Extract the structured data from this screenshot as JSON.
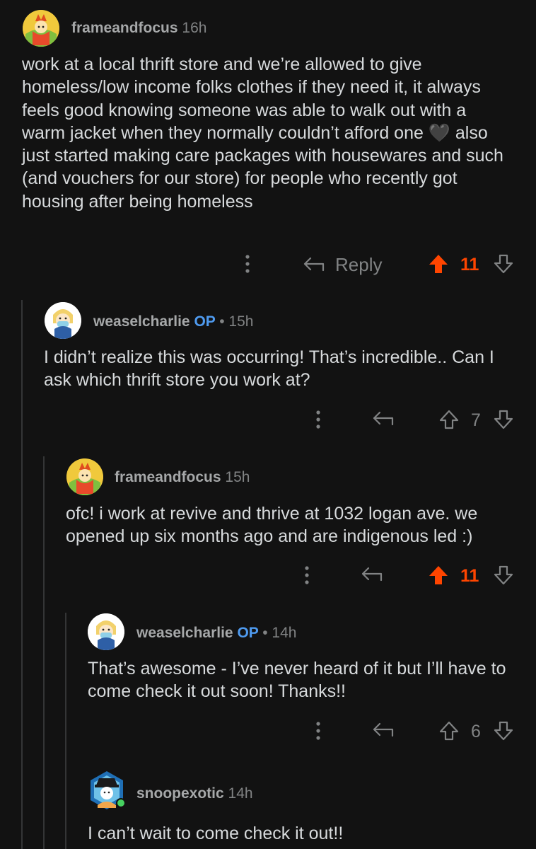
{
  "colors": {
    "background": "#121212",
    "text": "#d7dadc",
    "meta": "#818384",
    "op": "#4f9bf0",
    "upvoted": "#ff4500",
    "thread_line": "#343536"
  },
  "comments": [
    {
      "author": "frameandfocus",
      "time": "16h",
      "body": "work at a local thrift store and we’re allowed to give homeless/low income folks clothes if they need it, it always feels good knowing someone was able to walk out with a warm jacket when they normally couldn’t afford one 🖤 also just started making care packages with housewares and such (and vouchers for our store) for people who recently got housing after being homeless",
      "reply_label": "Reply",
      "votes": "11",
      "upvoted": true
    },
    {
      "author": "weaselcharlie",
      "op_badge": "OP",
      "time": "• 15h",
      "body": "I didn’t realize this was occurring! That’s incredible.. Can I ask which thrift store you work at?",
      "votes": "7",
      "upvoted": false
    },
    {
      "author": "frameandfocus",
      "time": "15h",
      "body": "ofc! i work at revive and thrive at 1032 logan ave. we opened up six months ago and are indigenous led :)",
      "votes": "11",
      "upvoted": true
    },
    {
      "author": "weaselcharlie",
      "op_badge": "OP",
      "time": "• 14h",
      "body": "That’s awesome - I’ve never heard of it but I’ll have to come check it out soon! Thanks!!",
      "votes": "6",
      "upvoted": false
    },
    {
      "author": "snoopexotic",
      "time": "14h",
      "body": "I can’t wait to come check it out!!"
    }
  ]
}
